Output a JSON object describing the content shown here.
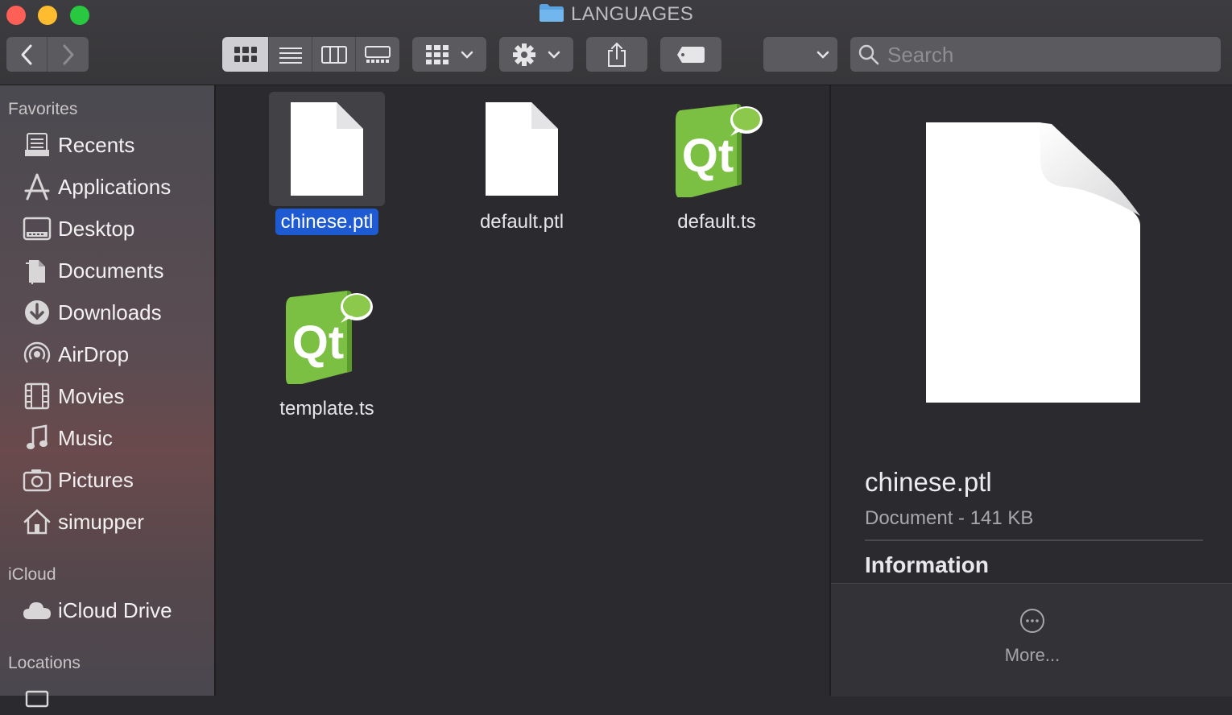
{
  "window": {
    "title": "LANGUAGES"
  },
  "toolbar": {
    "back_icon": "chevron-left-icon",
    "forward_icon": "chevron-right-icon",
    "view_modes": [
      "icon-view",
      "list-view",
      "column-view",
      "gallery-view"
    ],
    "active_view": "icon-view",
    "search": {
      "placeholder": "Search",
      "value": ""
    }
  },
  "sidebar": {
    "favorites_header": "Favorites",
    "favorites": [
      {
        "label": "Recents",
        "icon": "recents-icon"
      },
      {
        "label": "Applications",
        "icon": "applications-icon"
      },
      {
        "label": "Desktop",
        "icon": "desktop-icon"
      },
      {
        "label": "Documents",
        "icon": "documents-icon"
      },
      {
        "label": "Downloads",
        "icon": "downloads-icon"
      },
      {
        "label": "AirDrop",
        "icon": "airdrop-icon"
      },
      {
        "label": "Movies",
        "icon": "movies-icon"
      },
      {
        "label": "Music",
        "icon": "music-icon"
      },
      {
        "label": "Pictures",
        "icon": "pictures-icon"
      },
      {
        "label": "simupper",
        "icon": "home-icon"
      }
    ],
    "icloud_header": "iCloud",
    "icloud": [
      {
        "label": "iCloud Drive",
        "icon": "icloud-icon"
      }
    ],
    "locations_header": "Locations"
  },
  "files": [
    {
      "name": "chinese.ptl",
      "type": "document",
      "selected": true
    },
    {
      "name": "default.ptl",
      "type": "document",
      "selected": false
    },
    {
      "name": "default.ts",
      "type": "qt",
      "selected": false
    },
    {
      "name": "template.ts",
      "type": "qt",
      "selected": false
    }
  ],
  "preview": {
    "name": "chinese.ptl",
    "kind": "Document - 141 KB",
    "section": "Information",
    "more": "More..."
  },
  "colors": {
    "selection": "#1e5bd3",
    "qt_green": "#7bbf43"
  }
}
